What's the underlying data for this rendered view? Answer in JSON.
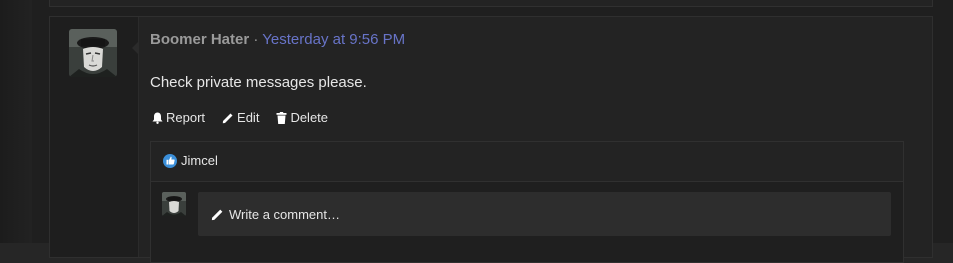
{
  "post": {
    "author": "Boomer Hater",
    "separator": "·",
    "time": "Yesterday at 9:56 PM",
    "message": "Check private messages please.",
    "actions": {
      "report": "Report",
      "edit": "Edit",
      "delete": "Delete"
    },
    "reactions": {
      "icon": "thumbs-up-icon",
      "users": "Jimcel"
    },
    "comment": {
      "placeholder": "Write a comment…"
    }
  },
  "colors": {
    "time_link": "#6874c8",
    "like_blue": "#3b8fd9",
    "author_gray": "#9a9a9a"
  }
}
